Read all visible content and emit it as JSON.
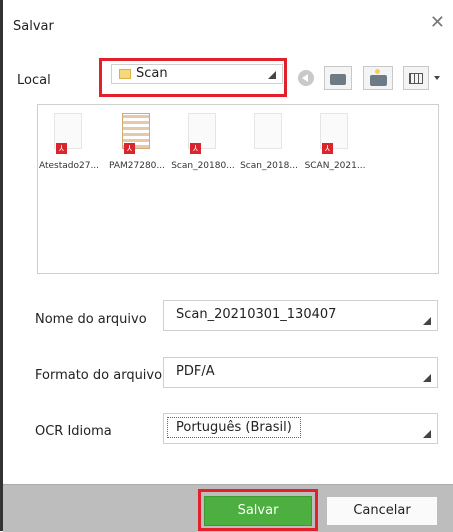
{
  "dialog": {
    "title": "Salvar",
    "close_symbol": "✕"
  },
  "location": {
    "label": "Local",
    "value": "Scan"
  },
  "files": [
    {
      "name": "Atestado27..."
    },
    {
      "name": "PAM27280..."
    },
    {
      "name": "Scan_20180..."
    },
    {
      "name": "Scan_2018..."
    },
    {
      "name": "SCAN_2021..."
    }
  ],
  "form": {
    "filename_label": "Nome do arquivo",
    "filename_value": "Scan_20210301_130407",
    "format_label": "Formato do arquivo",
    "format_value": "PDF/A",
    "ocr_label": "OCR Idioma",
    "ocr_value": "Português (Brasil)"
  },
  "buttons": {
    "save": "Salvar",
    "cancel": "Cancelar"
  },
  "colors": {
    "save_green": "#4caf3f",
    "highlight_red": "#e31f2b"
  }
}
